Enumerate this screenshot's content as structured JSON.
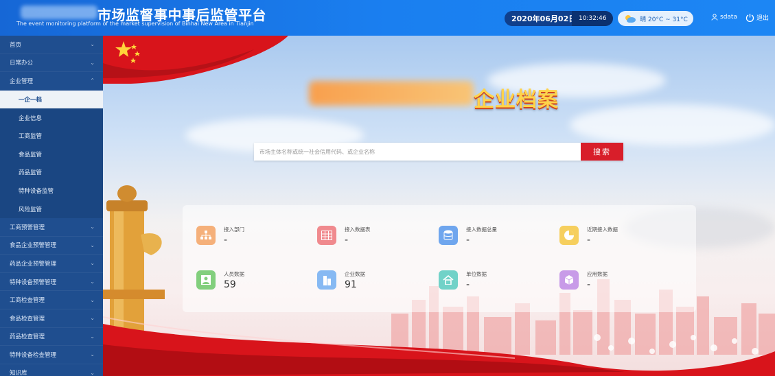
{
  "header": {
    "title": "市场监督事中事后监管平台",
    "subtitle": "The event monitoring platform of the market supervision of Binhai New Area in Tianjin",
    "date": "2020年06月02日",
    "time": "10:32:46",
    "weather": "晴 20°C ~ 31°C",
    "user": "sdata",
    "logout": "退出"
  },
  "sidebar": {
    "items": [
      {
        "label": "首页",
        "chev": "⌄"
      },
      {
        "label": "日常办公",
        "chev": "⌄"
      },
      {
        "label": "企业管理",
        "chev": "⌃"
      }
    ],
    "subitems": [
      {
        "label": "一企一档"
      },
      {
        "label": "企业信息"
      },
      {
        "label": "工商监管"
      },
      {
        "label": "食品监管"
      },
      {
        "label": "药品监管"
      },
      {
        "label": "特种设备监管"
      },
      {
        "label": "风险监管"
      }
    ],
    "items_after": [
      {
        "label": "工商预警管理",
        "chev": "⌄"
      },
      {
        "label": "食品企业预警管理",
        "chev": "⌄"
      },
      {
        "label": "药品企业预警管理",
        "chev": "⌄"
      },
      {
        "label": "特种设备预警管理",
        "chev": "⌄"
      },
      {
        "label": "工商检查管理",
        "chev": "⌄"
      },
      {
        "label": "食品检查管理",
        "chev": "⌄"
      },
      {
        "label": "药品检查管理",
        "chev": "⌄"
      },
      {
        "label": "特种设备检查管理",
        "chev": "⌄"
      },
      {
        "label": "知识库",
        "chev": "⌄"
      }
    ]
  },
  "main": {
    "banner": "企业档案",
    "search": {
      "placeholder": "市场主体名称或统一社会信用代码、或企业名称",
      "button": "搜索"
    },
    "stats": [
      {
        "label": "接入部门",
        "value": "-",
        "color": "#f5b07a",
        "icon": "org-chart-icon"
      },
      {
        "label": "接入数据表",
        "value": "-",
        "color": "#f08a8e",
        "icon": "table-icon"
      },
      {
        "label": "接入数据总量",
        "value": "-",
        "color": "#6fa6ee",
        "icon": "database-icon"
      },
      {
        "label": "近期接入数据",
        "value": "-",
        "color": "#f6cf5e",
        "icon": "pie-chart-icon"
      },
      {
        "label": "人员数据",
        "value": "59",
        "color": "#82cf7d",
        "icon": "person-icon"
      },
      {
        "label": "企业数据",
        "value": "91",
        "color": "#86b9f3",
        "icon": "building-icon"
      },
      {
        "label": "单位数据",
        "value": "-",
        "color": "#71d2c8",
        "icon": "home-icon"
      },
      {
        "label": "应用数据",
        "value": "-",
        "color": "#c89be8",
        "icon": "cube-icon"
      }
    ]
  }
}
